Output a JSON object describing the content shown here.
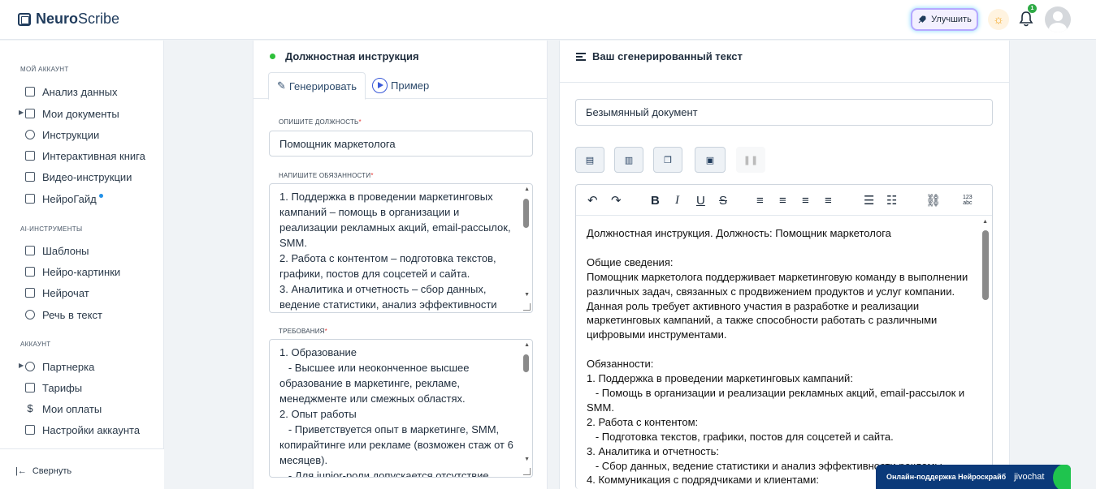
{
  "header": {
    "logo_bold": "Neuro",
    "logo_rest": "Scribe",
    "upgrade_label": "Улучшить",
    "notif_count": "1"
  },
  "sidebar": {
    "section_account": "Мой аккаунт",
    "items_account": [
      {
        "label": "Анализ данных",
        "icon": "grid-icon"
      },
      {
        "label": "Мои документы",
        "icon": "document-icon"
      },
      {
        "label": "Инструкции",
        "icon": "help-circle-icon"
      },
      {
        "label": "Интерактивная книга",
        "icon": "book-icon"
      },
      {
        "label": "Видео-инструкции",
        "icon": "video-icon"
      },
      {
        "label": "НейроГайд",
        "icon": "card-icon"
      }
    ],
    "section_ai": "AI-инструменты",
    "items_ai": [
      {
        "label": "Шаблоны",
        "icon": "layers-icon"
      },
      {
        "label": "Нейро-картинки",
        "icon": "image-icon"
      },
      {
        "label": "Нейрочат",
        "icon": "chat-icon"
      },
      {
        "label": "Речь в текст",
        "icon": "headphones-icon"
      }
    ],
    "section_acc2": "Аккаунт",
    "items_acc2": [
      {
        "label": "Партнерка",
        "icon": "users-icon"
      },
      {
        "label": "Тарифы",
        "icon": "tag-icon"
      },
      {
        "label": "Мои оплаты",
        "icon": "dollar-icon"
      },
      {
        "label": "Настройки аккаунта",
        "icon": "logout-icon"
      }
    ],
    "collapse_label": "Свернуть"
  },
  "left_panel": {
    "title": "Должностная инструкция",
    "tab_generate": "Генерировать",
    "tab_example": "Пример",
    "position_label": "Опишите должность",
    "position_value": "Помощник маркетолога",
    "duties_label": "Напишите обязанности",
    "duties_value": "1. Поддержка в проведении маркетинговых кампаний – помощь в организации и реализации рекламных акций, email-рассылок, SMM.\n2. Работа с контентом – подготовка текстов, графики, постов для соцсетей и сайта.\n3. Аналитика и отчетность – сбор данных, ведение статистики, анализ эффективности",
    "requirements_label": "Требования",
    "requirements_value": "1. Образование\n   - Высшее или неоконченное высшее образование в маркетинге, рекламе, менеджменте или смежных областях.\n2. Опыт работы\n   - Приветствуется опыт в маркетинге, SMM, копирайтинге или рекламе (возможен стаж от 6 месяцев).\n   - Для junior-роли допускается отсутствие"
  },
  "right_panel": {
    "title": "Ваш сгенерированный текст",
    "doc_name": "Безымянный документ",
    "editor_text": "Должностная инструкция. Должность: Помощник маркетолога\n\nОбщие сведения:\nПомощник маркетолога поддерживает маркетинговую команду в выполнении различных задач, связанных с продвижением продуктов и услуг компании. Данная роль требует активного участия в разработке и реализации маркетинговых кампаний, а также способности работать с различными цифровыми инструментами.\n\nОбязанности:\n1. Поддержка в проведении маркетинговых кампаний:\n   - Помощь в организации и реализации рекламных акций, email-рассылок и SMM.\n2. Работа с контентом:\n   - Подготовка текстов, графики, постов для соцсетей и сайта.\n3. Аналитика и отчетность:\n   - Сбор данных, ведение статистики и анализ эффективности рекламы.\n4. Коммуникация с подрядчиками и клиентами:"
  },
  "chat": {
    "text": "Онлайн-поддержка Нейроскрайб",
    "brand": "jivochat"
  },
  "colors": {
    "accent": "#2ec03a",
    "brand": "#1f3b5c",
    "chat_bg": "#0b3a7a"
  }
}
